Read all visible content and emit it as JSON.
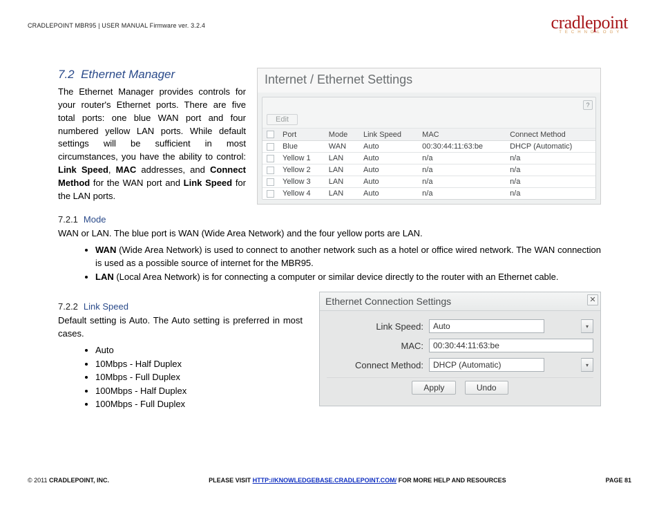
{
  "header": {
    "doc_line": "CRADLEPOINT MBR95 | USER MANUAL Firmware ver. 3.2.4",
    "logo_main": "cradlepoint",
    "logo_sub": "TECHNOLOGY"
  },
  "section": {
    "number": "7.2",
    "title": "Ethernet Manager",
    "intro_pre": "The Ethernet Manager provides controls for your router's Ethernet ports. There are five total ports: one blue WAN port and four numbered yellow LAN ports. While default settings will be sufficient in most circumstances, you have the ability to control: ",
    "b1": "Link Speed",
    "sep": ", ",
    "b2": "MAC",
    "mid": " addresses, and ",
    "b3": "Connect Method",
    "mid2": " for the WAN port and ",
    "b4": "Link Speed",
    "tail": " for the LAN ports."
  },
  "panel": {
    "title": "Internet / Ethernet Settings",
    "edit": "Edit",
    "columns": [
      "",
      "Port",
      "Mode",
      "Link Speed",
      "MAC",
      "Connect Method"
    ],
    "rows": [
      {
        "port": "Blue",
        "mode": "WAN",
        "speed": "Auto",
        "mac": "00:30:44:11:63:be",
        "cm": "DHCP (Automatic)"
      },
      {
        "port": "Yellow 1",
        "mode": "LAN",
        "speed": "Auto",
        "mac": "n/a",
        "cm": "n/a"
      },
      {
        "port": "Yellow 2",
        "mode": "LAN",
        "speed": "Auto",
        "mac": "n/a",
        "cm": "n/a"
      },
      {
        "port": "Yellow 3",
        "mode": "LAN",
        "speed": "Auto",
        "mac": "n/a",
        "cm": "n/a"
      },
      {
        "port": "Yellow 4",
        "mode": "LAN",
        "speed": "Auto",
        "mac": "n/a",
        "cm": "n/a"
      }
    ]
  },
  "mode_sub": {
    "num": "7.2.1",
    "label": "Mode",
    "line": "WAN or LAN. The blue port is WAN (Wide Area Network) and the four yellow ports are LAN."
  },
  "mode_bullets": {
    "wan_b": "WAN",
    "wan_t": " (Wide Area Network) is used to connect to another network such as a hotel or office wired network. The WAN connection is used as a possible source of internet for the MBR95.",
    "lan_b": "LAN",
    "lan_t": " (Local Area Network) is for connecting a computer or similar device directly to the router with an Ethernet cable."
  },
  "link_sub": {
    "num": "7.2.2",
    "label": "Link Speed",
    "line": "Default setting is Auto. The Auto setting is preferred in most cases."
  },
  "link_options": [
    "Auto",
    "10Mbps - Half Duplex",
    "10Mbps - Full Duplex",
    "100Mbps - Half Duplex",
    "100Mbps - Full Duplex"
  ],
  "dialog": {
    "title": "Ethernet Connection Settings",
    "link_label": "Link Speed:",
    "link_value": "Auto",
    "mac_label": "MAC:",
    "mac_value": "00:30:44:11:63:be",
    "cm_label": "Connect Method:",
    "cm_value": "DHCP (Automatic)",
    "apply": "Apply",
    "undo": "Undo"
  },
  "footer": {
    "left": "© 2011 CRADLEPOINT, INC.",
    "mid_pre": "PLEASE VISIT ",
    "mid_link": "HTTP://KNOWLEDGEBASE.CRADLEPOINT.COM/",
    "mid_post": " FOR MORE HELP AND RESOURCES",
    "right": "PAGE 81"
  }
}
